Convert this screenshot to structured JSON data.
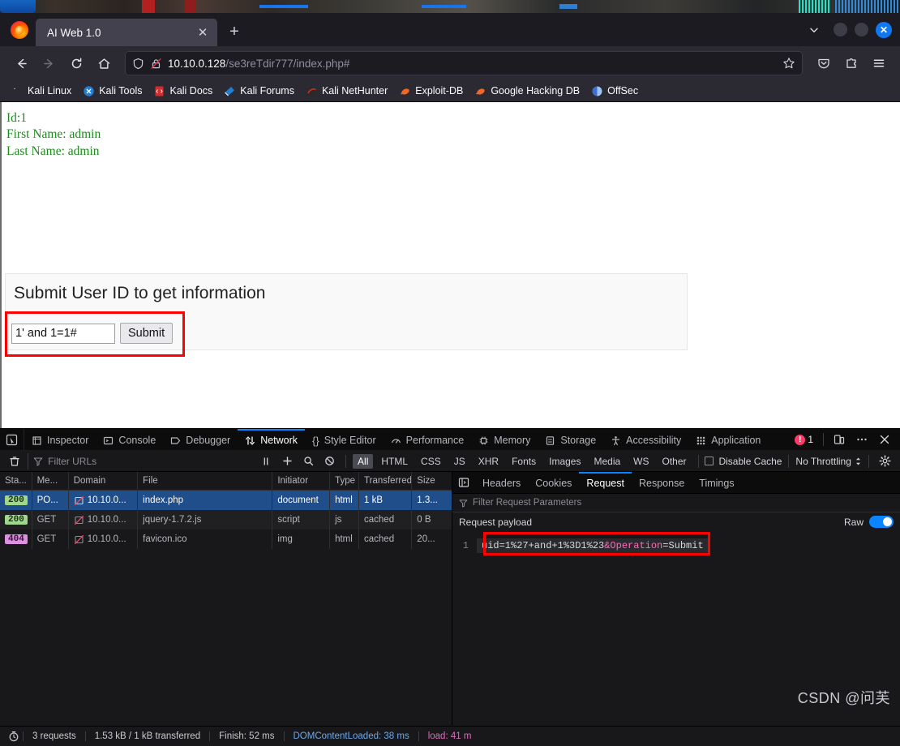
{
  "window": {
    "title": "AI Web 1.0"
  },
  "tabstrip": {
    "tab_title": "AI Web 1.0",
    "close_label": "✕",
    "new_tab_label": "+",
    "list_all_tabs_icon": "chevron-down-icon",
    "minimize_label": "",
    "maximize_label": "",
    "close_window_label": "✕"
  },
  "navbar": {
    "back_icon": "back-arrow-icon",
    "forward_icon": "forward-arrow-icon",
    "reload_icon": "reload-icon",
    "home_icon": "home-icon",
    "shield_icon": "shield-icon",
    "lock_icon": "insecure-lock-icon",
    "url_host": "10.10.0.128",
    "url_path": "/se3reTdir777/index.php#",
    "url_full": "10.10.0.128/se3reTdir777/index.php#",
    "bookmark_icon": "star-icon",
    "pocket_icon": "pocket-icon",
    "extensions_icon": "extensions-icon",
    "menu_icon": "hamburger-menu-icon"
  },
  "bookmarks": [
    {
      "label": "Kali Linux",
      "icon": "kali-dragon-icon"
    },
    {
      "label": "Kali Tools",
      "icon": "kali-tools-icon"
    },
    {
      "label": "Kali Docs",
      "icon": "kali-docs-icon"
    },
    {
      "label": "Kali Forums",
      "icon": "kali-forums-icon"
    },
    {
      "label": "Kali NetHunter",
      "icon": "kali-nethunter-icon"
    },
    {
      "label": "Exploit-DB",
      "icon": "exploit-db-icon"
    },
    {
      "label": "Google Hacking DB",
      "icon": "google-hacking-db-icon"
    },
    {
      "label": "OffSec",
      "icon": "offsec-icon"
    }
  ],
  "page": {
    "result_id": "Id:1",
    "result_first_name": "First Name: admin",
    "result_last_name": "Last Name: admin",
    "form_heading": "Submit User ID to get information",
    "uid_value": "1' and 1=1#",
    "uid_placeholder": "",
    "submit_label": "Submit",
    "text_color": "#1d8a1d",
    "highlight_color": "#ff0000"
  },
  "devtools": {
    "picker_icon": "element-picker-icon",
    "tabs": [
      {
        "label": "Inspector",
        "icon": "inspector-icon",
        "active": false
      },
      {
        "label": "Console",
        "icon": "console-icon",
        "active": false
      },
      {
        "label": "Debugger",
        "icon": "debugger-icon",
        "active": false
      },
      {
        "label": "Network",
        "icon": "network-icon",
        "active": true
      },
      {
        "label": "Style Editor",
        "icon": "style-editor-icon",
        "active": false
      },
      {
        "label": "Performance",
        "icon": "performance-icon",
        "active": false
      },
      {
        "label": "Memory",
        "icon": "memory-icon",
        "active": false
      },
      {
        "label": "Storage",
        "icon": "storage-icon",
        "active": false
      },
      {
        "label": "Accessibility",
        "icon": "accessibility-icon",
        "active": false
      },
      {
        "label": "Application",
        "icon": "application-icon",
        "active": false
      }
    ],
    "error_count": "1",
    "responsive_icon": "responsive-design-mode-icon",
    "more_icon": "meatball-menu-icon",
    "close_icon": "close-icon",
    "filterbar": {
      "trash_icon": "trash-icon",
      "filter_placeholder": "Filter URLs",
      "pause_icon": "pause-icon",
      "plus_icon": "plus-icon",
      "search_icon": "search-icon",
      "block_icon": "block-icon",
      "types": [
        "All",
        "HTML",
        "CSS",
        "JS",
        "XHR",
        "Fonts",
        "Images",
        "Media",
        "WS",
        "Other"
      ],
      "active_type": "All",
      "disable_cache_label": "Disable Cache",
      "disable_cache_checked": false,
      "throttling_label": "No Throttling",
      "gear_icon": "settings-gear-icon"
    },
    "network_table": {
      "columns": [
        "Sta...",
        "Me...",
        "Domain",
        "File",
        "Initiator",
        "Type",
        "Transferred",
        "Size"
      ],
      "rows": [
        {
          "status": "200",
          "status_kind": "ok",
          "method": "PO...",
          "domain": "10.10.0...",
          "file": "index.php",
          "initiator": "document",
          "type": "html",
          "transferred": "1 kB",
          "size": "1.3...",
          "selected": true
        },
        {
          "status": "200",
          "status_kind": "ok",
          "method": "GET",
          "domain": "10.10.0...",
          "file": "jquery-1.7.2.js",
          "initiator": "script",
          "type": "js",
          "transferred": "cached",
          "size": "0 B",
          "selected": false
        },
        {
          "status": "404",
          "status_kind": "notfound",
          "method": "GET",
          "domain": "10.10.0...",
          "file": "favicon.ico",
          "initiator": "img",
          "type": "html",
          "transferred": "cached",
          "size": "20...",
          "selected": false
        }
      ]
    },
    "details": {
      "panel_toggle_icon": "toggle-panel-icon",
      "tabs": [
        {
          "label": "Headers",
          "active": false
        },
        {
          "label": "Cookies",
          "active": false
        },
        {
          "label": "Request",
          "active": true
        },
        {
          "label": "Response",
          "active": false
        },
        {
          "label": "Timings",
          "active": false
        }
      ],
      "param_filter_placeholder": "Filter Request Parameters",
      "payload_title": "Request payload",
      "raw_label": "Raw",
      "raw_enabled": true,
      "line_number": "1",
      "payload_pre": "uid=1%27+and+1%3D1%23",
      "payload_param": "&Operation",
      "payload_post": "=Submit",
      "payload_full": "uid=1%27+and+1%3D1%23&Operation=Submit"
    },
    "statusbar": {
      "timer_icon": "stopwatch-icon",
      "requests": "3 requests",
      "transferred": "1.53 kB / 1 kB transferred",
      "finish": "Finish: 52 ms",
      "domcontentloaded": "DOMContentLoaded: 38 ms",
      "load": "load: 41 m"
    }
  },
  "watermark": "CSDN @问芙"
}
